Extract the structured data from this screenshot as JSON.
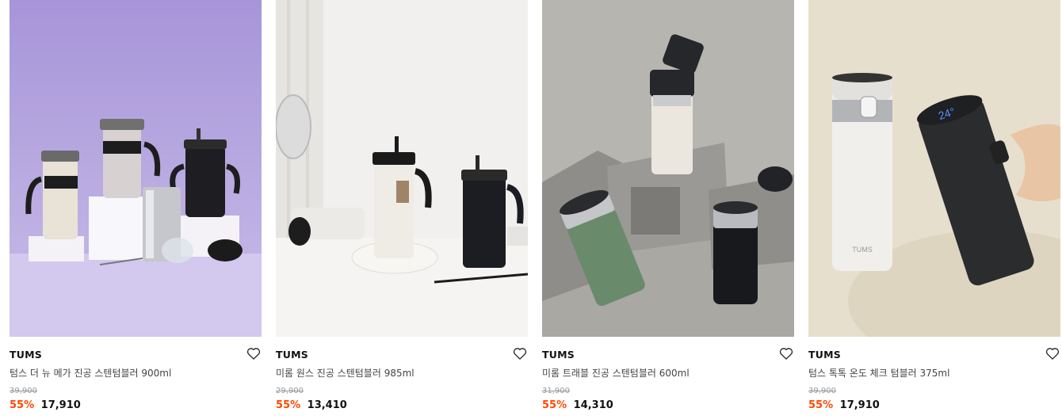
{
  "colors": {
    "discount": "#ff4800",
    "strike": "#999999",
    "brand": "#111111"
  },
  "products": [
    {
      "brand": "TUMS",
      "name": "텀스 더 뉴 메가 진공 스텐텀블러 900ml",
      "original_price": "39,900",
      "discount": "55%",
      "price": "17,910",
      "wishlist_icon": "heart-outline-icon"
    },
    {
      "brand": "TUMS",
      "name": "미롬 원스 진공 스텐텀블러 985ml",
      "original_price": "29,900",
      "discount": "55%",
      "price": "13,410",
      "wishlist_icon": "heart-outline-icon"
    },
    {
      "brand": "TUMS",
      "name": "미롬 트래블 진공 스텐텀블러 600ml",
      "original_price": "31,900",
      "discount": "55%",
      "price": "14,310",
      "wishlist_icon": "heart-outline-icon"
    },
    {
      "brand": "TUMS",
      "name": "텀스 톡톡 온도 체크 텀블러 375ml",
      "original_price": "39,900",
      "discount": "55%",
      "price": "17,910",
      "wishlist_icon": "heart-outline-icon"
    }
  ],
  "images": {
    "temp_display": "24°"
  }
}
